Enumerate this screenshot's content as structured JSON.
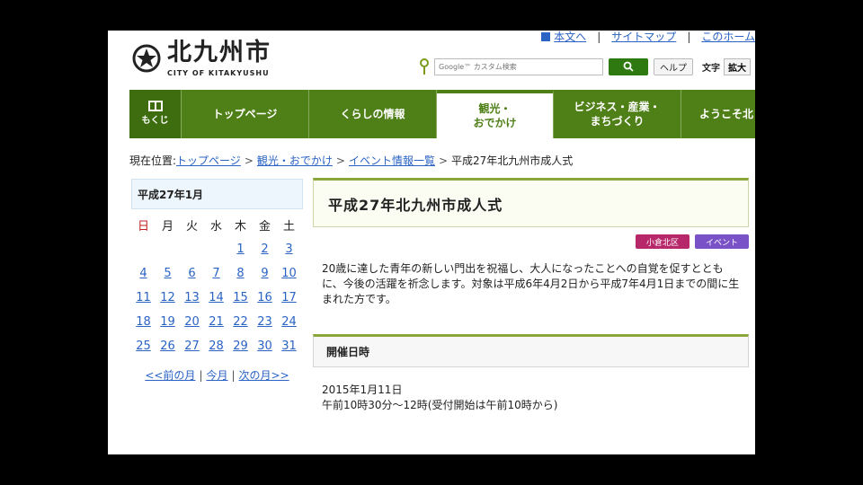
{
  "header": {
    "logo_jp": "北九州市",
    "logo_en": "CITY OF KITAKYUSHU",
    "links": [
      "本文へ",
      "サイトマップ",
      "このホーム"
    ],
    "search": {
      "placeholder": "Google™ カスタム検索",
      "button_icon": "search-icon"
    },
    "help_label": "ヘルプ",
    "moji_label": "文字",
    "kakudai_label": "拡大"
  },
  "nav": {
    "menu_label": "もくじ",
    "items": [
      "トップページ",
      "くらしの情報",
      "観光・\nおでかけ",
      "ビジネス・産業・\nまちづくり",
      "ようこそ北"
    ]
  },
  "breadcrumb": {
    "prefix": "現在位置:",
    "items": [
      "トップページ",
      "観光・おでかけ",
      "イベント情報一覧"
    ],
    "current": "平成27年北九州市成人式",
    "separator": ">"
  },
  "calendar": {
    "title": "平成27年1月",
    "weekdays": [
      "日",
      "月",
      "火",
      "水",
      "木",
      "金",
      "土"
    ],
    "weeks": [
      [
        "",
        "",
        "",
        "",
        "1",
        "2",
        "3"
      ],
      [
        "4",
        "5",
        "6",
        "7",
        "8",
        "9",
        "10"
      ],
      [
        "11",
        "12",
        "13",
        "14",
        "15",
        "16",
        "17"
      ],
      [
        "18",
        "19",
        "20",
        "21",
        "22",
        "23",
        "24"
      ],
      [
        "25",
        "26",
        "27",
        "28",
        "29",
        "30",
        "31"
      ]
    ],
    "prev_label": "<<前の月",
    "today_label": "今月",
    "next_label": "次の月>>",
    "link_color": "#2a63c4",
    "sunday_color": "#c02020"
  },
  "main": {
    "title": "平成27年北九州市成人式",
    "tags": [
      {
        "label": "小倉北区",
        "color": "#b7286a"
      },
      {
        "label": "イベント",
        "color": "#7a52c7"
      }
    ],
    "description": "20歳に達した青年の新しい門出を祝福し、大人になったことへの自覚を促すとともに、今後の活躍を祈念します。対象は平成6年4月2日から平成7年4月1日までの間に生まれた方です。",
    "section_title": "開催日時",
    "date_line1": "2015年1月11日",
    "date_line2": "午前10時30分～12時(受付開始は午前10時から)"
  },
  "colors": {
    "nav_green": "#4f7f17",
    "accent_green": "#8ba63b",
    "link_blue": "#2a63c4"
  }
}
